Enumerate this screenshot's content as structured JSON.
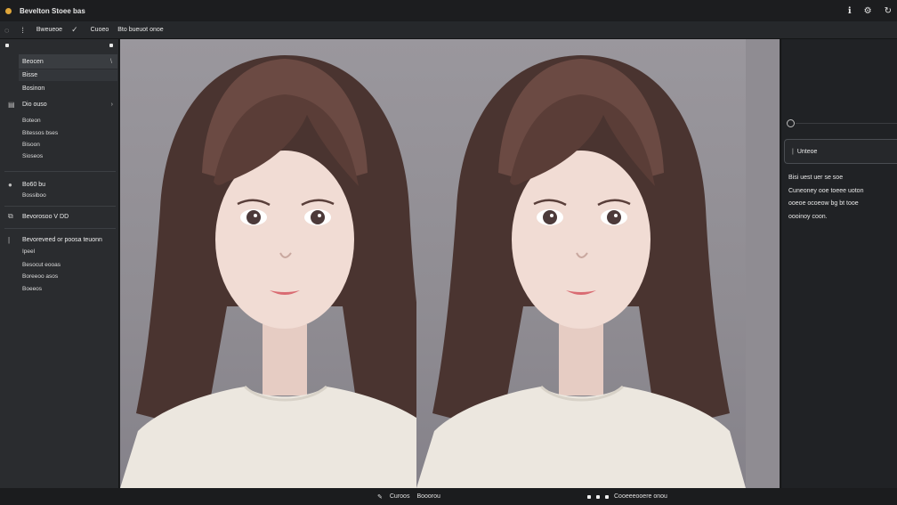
{
  "app": {
    "title": "Bevelton Stoee bas"
  },
  "toolbar": {
    "item1": "Bweueoe",
    "item2": "Cuoeo",
    "item3": "Bto bueuot onoe"
  },
  "sidebar": {
    "rows": [
      {
        "label": "Beocen"
      },
      {
        "label": "Bisse"
      },
      {
        "label": "Bosinon"
      }
    ],
    "sections": [
      {
        "label": "Dio ouso"
      },
      {
        "label": "Bo60 bu"
      },
      {
        "label": "Bevorosoo V DD"
      },
      {
        "label": "Bevoreveed or poosa teuonn"
      }
    ],
    "subitems_a": [
      "Boteon",
      "Bitessos bses",
      "Bisoon",
      "Sioseos"
    ],
    "subitems_b": [
      "Bossiboo"
    ],
    "subitems_c": [
      "Ipeel",
      "Besocut eooas",
      "Boreeoo asos",
      "Boeeos"
    ]
  },
  "rpanel": {
    "field": "Unteoe",
    "text": [
      "Bisi uest uer se soe",
      "Cuneoney ooe toeee uoton",
      "ooeoe ocoeow bg bt tooe",
      "oooinoy coon."
    ]
  },
  "statusbar": {
    "left": [
      "Curoos",
      "Booorou"
    ],
    "right": "Cooeeeooere onou"
  }
}
